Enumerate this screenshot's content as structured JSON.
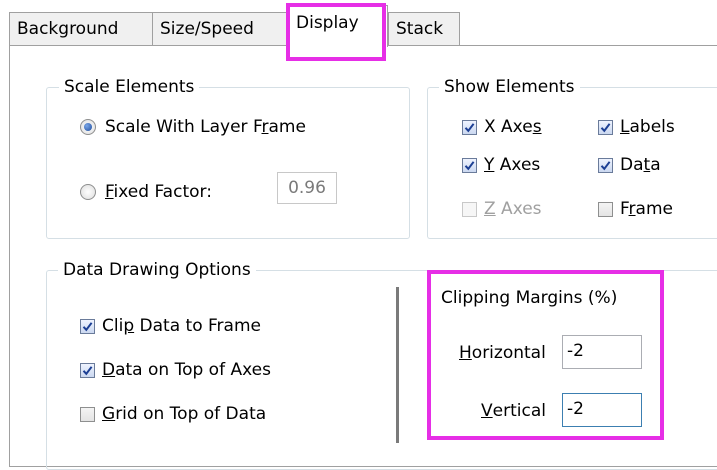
{
  "tabs": [
    {
      "label": "Background",
      "active": false
    },
    {
      "label": "Size/Speed",
      "active": false
    },
    {
      "label": "Display",
      "active": true
    },
    {
      "label": "Stack",
      "active": false
    }
  ],
  "scale_elements": {
    "title": "Scale Elements",
    "option_scale_with_layer": {
      "label_pre": "Scale With Layer F",
      "label_acc": "r",
      "label_post": "ame",
      "selected": true
    },
    "option_fixed_factor": {
      "label_pre": "",
      "label_acc": "F",
      "label_post": "ixed Factor:",
      "selected": false
    },
    "fixed_factor_value": "0.96"
  },
  "show_elements": {
    "title": "Show Elements",
    "x_axes": {
      "pre": "X Axe",
      "acc": "s",
      "post": "",
      "checked": true
    },
    "y_axes": {
      "pre": "",
      "acc": "Y",
      "post": " Axes",
      "checked": true
    },
    "z_axes": {
      "pre": "",
      "acc": "Z",
      "post": " Axes",
      "checked": false,
      "disabled": true
    },
    "labels": {
      "pre": "",
      "acc": "L",
      "post": "abels",
      "checked": true
    },
    "data": {
      "pre": "Da",
      "acc": "t",
      "post": "a",
      "checked": true
    },
    "frame": {
      "pre": "F",
      "acc": "r",
      "post": "ame",
      "checked": false
    }
  },
  "data_drawing": {
    "title": "Data Drawing Options",
    "clip_data": {
      "pre": "Cli",
      "acc": "p",
      "post": " Data to Frame",
      "checked": true
    },
    "data_on_top": {
      "pre": "",
      "acc": "D",
      "post": "ata on Top of Axes",
      "checked": true
    },
    "grid_on_top": {
      "pre": "",
      "acc": "G",
      "post": "rid on Top of Data",
      "checked": false
    }
  },
  "clipping_margins": {
    "title": "Clipping Margins (%)",
    "horizontal_label": {
      "pre": "",
      "acc": "H",
      "post": "orizontal"
    },
    "horizontal_value": "-2",
    "vertical_label": {
      "pre": "",
      "acc": "V",
      "post": "ertical"
    },
    "vertical_value": "-2"
  },
  "colors": {
    "highlight": "#e62ee6",
    "checkbox_check": "#1c3f94"
  }
}
